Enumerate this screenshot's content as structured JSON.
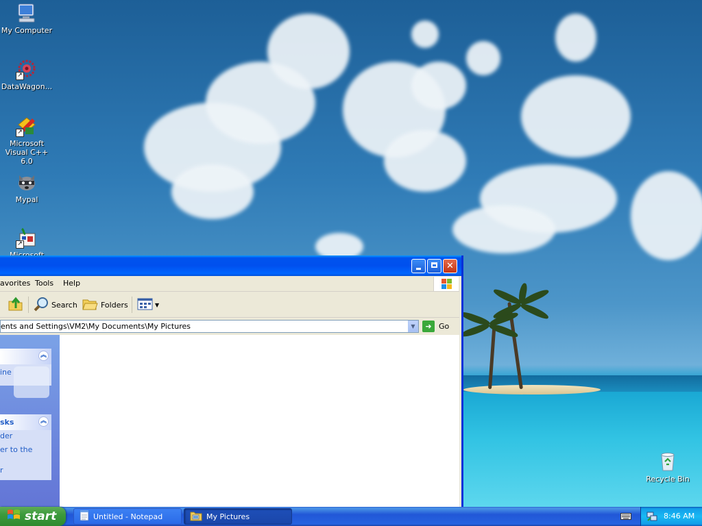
{
  "desktop": {
    "icons": [
      {
        "label": "My Computer"
      },
      {
        "label": "DataWagon..."
      },
      {
        "label": "Microsoft Visual C++ 6.0"
      },
      {
        "label": "Mypal"
      },
      {
        "label": "Microsoft Visual"
      }
    ],
    "recycle_bin": {
      "label": "Recycle Bin"
    }
  },
  "window": {
    "menu": [
      "avorites",
      "Tools",
      "Help"
    ],
    "toolbar": {
      "search": "Search",
      "folders": "Folders"
    },
    "address": {
      "value": "ents and Settings\\VM2\\My Documents\\My Pictures",
      "go": "Go"
    },
    "taskpane": {
      "box1_link": "ine",
      "box2_title": "sks",
      "box2_links": [
        "der",
        "er to the",
        "r"
      ]
    }
  },
  "taskbar": {
    "start": "start",
    "tasks": [
      {
        "label": "Untitled - Notepad",
        "active": false
      },
      {
        "label": "My Pictures",
        "active": true
      }
    ],
    "clock": "8:46 AM"
  },
  "colors": {
    "title_blue": "#0054e3",
    "taskbar_blue": "#245edb",
    "start_green": "#3c9a3c",
    "link_blue": "#215dc6"
  },
  "icons": {
    "desktop": [
      "my-computer-icon",
      "datawagon-icon",
      "visual-cpp-icon",
      "mypal-icon",
      "visual-studio-icon",
      "recycle-bin-icon"
    ],
    "toolbar": [
      "up-folder-icon",
      "search-icon",
      "folders-icon",
      "views-icon"
    ],
    "tray": [
      "keyboard-icon",
      "network-icon"
    ]
  }
}
